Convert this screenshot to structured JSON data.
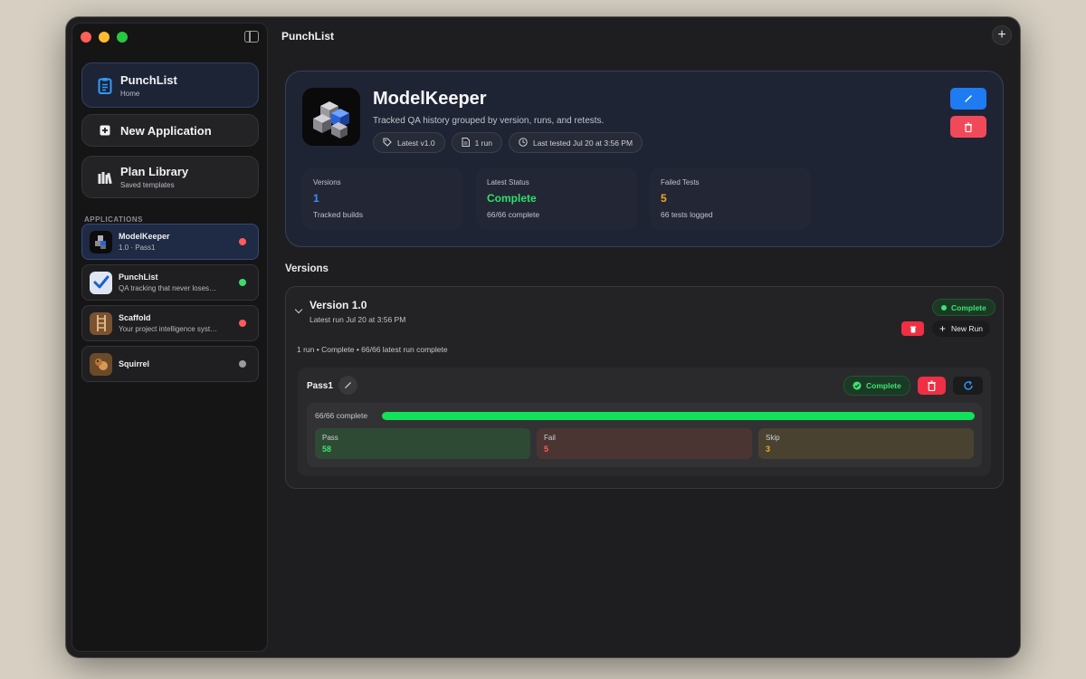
{
  "window": {
    "title": "PunchList"
  },
  "sidebar": {
    "home": {
      "title": "PunchList",
      "subtitle": "Home"
    },
    "new_app": {
      "label": "New Application"
    },
    "plan_library": {
      "title": "Plan Library",
      "subtitle": "Saved templates"
    },
    "section_label": "APPLICATIONS",
    "apps": [
      {
        "name": "ModelKeeper",
        "desc": "1.0 · Pass1",
        "status_color": "#ff5b5b",
        "icon": "cubes-icon"
      },
      {
        "name": "PunchList",
        "desc": "QA tracking that never loses track of a test",
        "status_color": "#3ddc6a",
        "icon": "checkmark-icon"
      },
      {
        "name": "Scaffold",
        "desc": "Your project intelligence system",
        "status_color": "#ff5b5b",
        "icon": "ladder-icon"
      },
      {
        "name": "Squirrel",
        "desc": "",
        "status_color": "#9a9aa0",
        "icon": "squirrel-icon"
      }
    ]
  },
  "app": {
    "name": "ModelKeeper",
    "description": "Tracked QA history grouped by version, runs, and retests.",
    "chips": {
      "latest": "Latest v1.0",
      "runs": "1 run",
      "last_tested": "Last tested Jul 20 at 3:56 PM"
    },
    "stats": [
      {
        "label": "Versions",
        "value": "1",
        "sub": "Tracked builds",
        "color": "#3d8bff"
      },
      {
        "label": "Latest Status",
        "value": "Complete",
        "sub": "66/66 complete",
        "color": "#2fe06a"
      },
      {
        "label": "Failed Tests",
        "value": "5",
        "sub": "66 tests logged",
        "color": "#f5a623"
      }
    ]
  },
  "versions_heading": "Versions",
  "version": {
    "title": "Version 1.0",
    "subtitle": "Latest run Jul 20 at 3:56 PM",
    "status": "Complete",
    "new_run_label": "New Run",
    "summary": "1 run • Complete • 66/66 latest run complete",
    "run": {
      "name": "Pass1",
      "status": "Complete",
      "progress_label": "66/66 complete",
      "progress_fraction": 1.0,
      "counts": [
        {
          "label": "Pass",
          "value": "58",
          "color": "#3fe36e",
          "bg": "#2e4a35"
        },
        {
          "label": "Fail",
          "value": "5",
          "color": "#ff5a5a",
          "bg": "#4a3533"
        },
        {
          "label": "Skip",
          "value": "3",
          "color": "#f5a623",
          "bg": "#4a4230"
        }
      ]
    }
  },
  "colors": {
    "accent": "#1f7bf2",
    "danger": "#ef2f44",
    "success": "#12e25a"
  }
}
